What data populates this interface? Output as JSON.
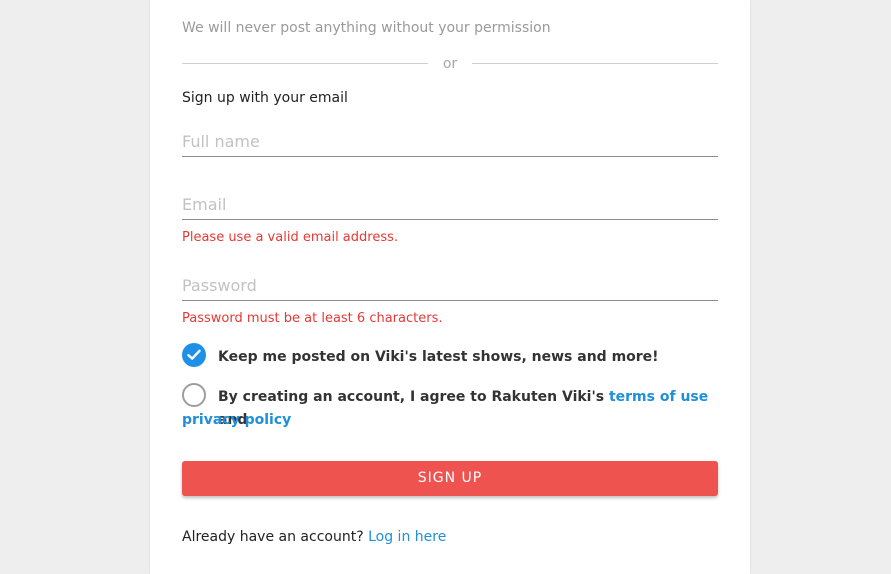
{
  "notice_text": "We will never post anything without your permission",
  "divider_text": "or",
  "signup_heading": "Sign up with your email",
  "fields": {
    "full_name": {
      "placeholder": "Full name",
      "value": ""
    },
    "email": {
      "placeholder": "Email",
      "value": "",
      "error": "Please use a valid email address."
    },
    "password": {
      "placeholder": "Password",
      "value": "",
      "error": "Password must be at least 6 characters."
    }
  },
  "checkboxes": {
    "keep_posted": {
      "label": "Keep me posted on Viki's latest shows, news and more!",
      "checked": true
    },
    "terms": {
      "label_prefix": "By creating an account, I agree to Rakuten Viki's ",
      "terms_link": "terms of use",
      "label_and": " and",
      "privacy_link": "privacy policy",
      "checked": false
    }
  },
  "signup_button": "SIGN UP",
  "login": {
    "prompt": "Already have an account? ",
    "link": "Log in here"
  },
  "colors": {
    "accent_red": "#ef5350",
    "link_blue": "#1e8fd8",
    "error_red": "#e53935",
    "check_blue": "#1e90e8"
  },
  "icons": {
    "checked": "checkmark-circle-icon",
    "unchecked": "empty-circle-icon"
  }
}
